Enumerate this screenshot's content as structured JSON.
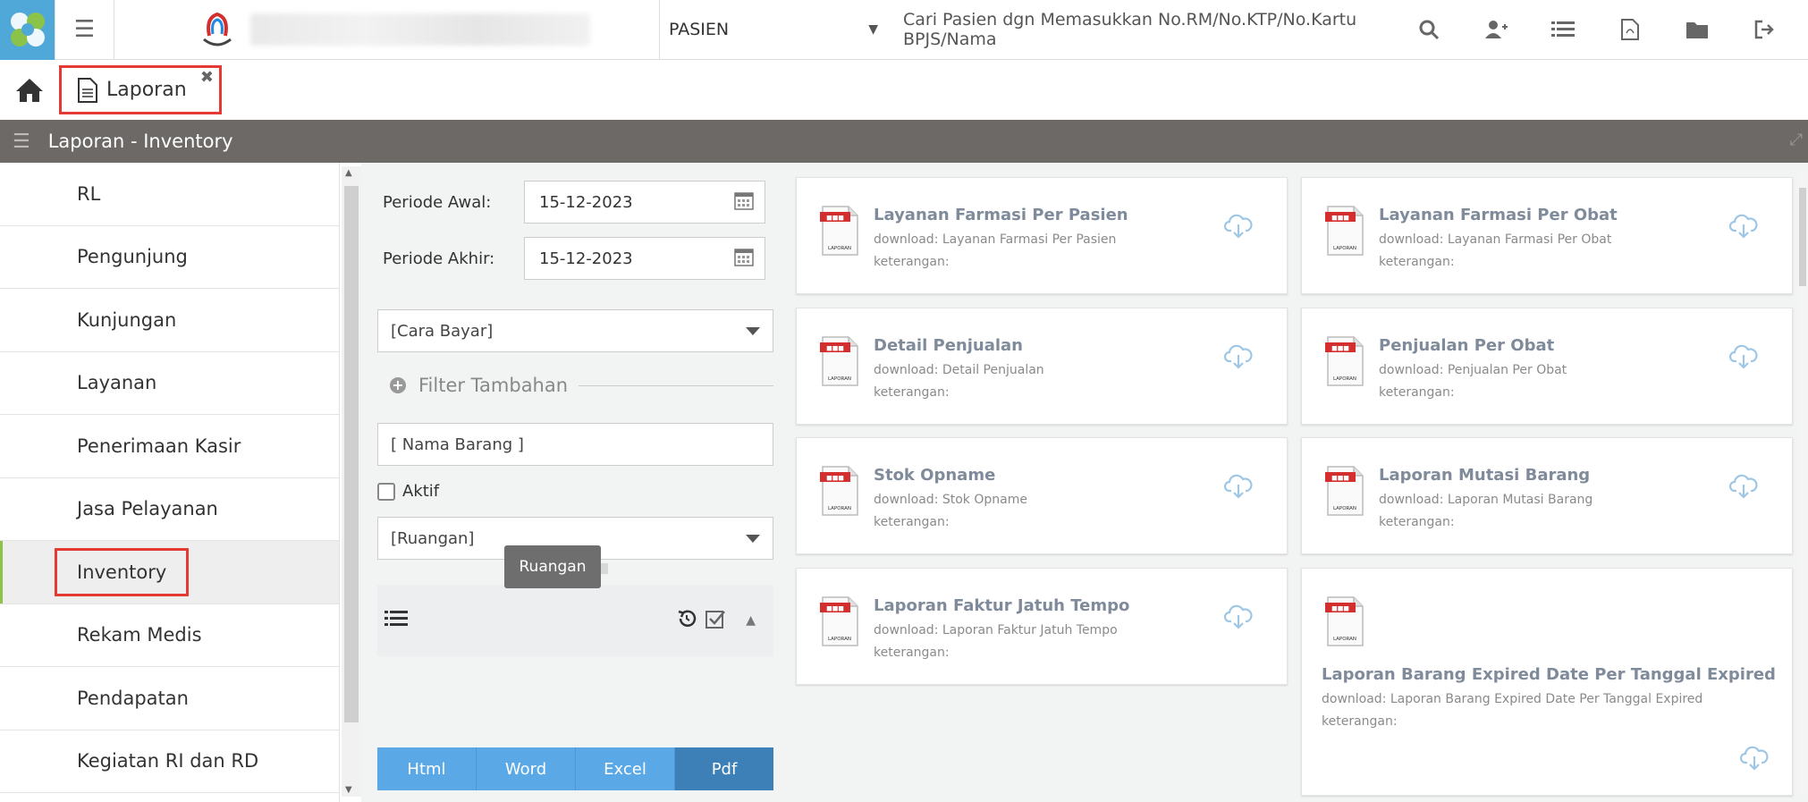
{
  "header": {
    "pasien_select": "PASIEN",
    "search_placeholder": "Cari Pasien dgn Memasukkan No.RM/No.KTP/No.Kartu BPJS/Nama",
    "icons": [
      "search-icon",
      "add-user-icon",
      "list-icon",
      "pdf-file-icon",
      "folder-icon",
      "logout-icon"
    ]
  },
  "tabs": [
    {
      "label": "Laporan"
    }
  ],
  "section": {
    "title": "Laporan - Inventory"
  },
  "sidebar": {
    "items": [
      {
        "label": "RL"
      },
      {
        "label": "Pengunjung"
      },
      {
        "label": "Kunjungan"
      },
      {
        "label": "Layanan"
      },
      {
        "label": "Penerimaan Kasir"
      },
      {
        "label": "Jasa Pelayanan"
      },
      {
        "label": "Inventory",
        "active": true
      },
      {
        "label": "Rekam Medis"
      },
      {
        "label": "Pendapatan"
      },
      {
        "label": "Kegiatan RI dan RD"
      }
    ]
  },
  "filter": {
    "periode_awal_label": "Periode Awal:",
    "periode_awal_value": "15-12-2023",
    "periode_akhir_label": "Periode Akhir:",
    "periode_akhir_value": "15-12-2023",
    "cara_bayar": "[Cara Bayar]",
    "filter_tambahan": "Filter Tambahan",
    "nama_barang_placeholder": "[ Nama Barang ]",
    "aktif_label": "Aktif",
    "ruangan": "[Ruangan]",
    "tooltip": "Ruangan",
    "export_buttons": [
      "Html",
      "Word",
      "Excel",
      "Pdf"
    ]
  },
  "reports": [
    {
      "title": "Layanan Farmasi Per Pasien",
      "download": "download: Layanan Farmasi Per Pasien",
      "keterangan": "keterangan:"
    },
    {
      "title": "Layanan Farmasi Per Obat",
      "download": "download: Layanan Farmasi Per Obat",
      "keterangan": "keterangan:"
    },
    {
      "title": "Detail Penjualan",
      "download": "download: Detail Penjualan",
      "keterangan": "keterangan:"
    },
    {
      "title": "Penjualan Per Obat",
      "download": "download: Penjualan Per Obat",
      "keterangan": "keterangan:"
    },
    {
      "title": "Stok Opname",
      "download": "download: Stok Opname",
      "keterangan": "keterangan:"
    },
    {
      "title": "Laporan Mutasi Barang",
      "download": "download: Laporan Mutasi Barang",
      "keterangan": "keterangan:"
    },
    {
      "title": "Laporan Faktur Jatuh Tempo",
      "download": "download: Laporan Faktur Jatuh Tempo",
      "keterangan": "keterangan:"
    },
    {
      "title": "Laporan Barang Expired Date Per Tanggal Expired",
      "download": "download: Laporan Barang Expired Date Per Tanggal Expired",
      "keterangan": "keterangan:"
    }
  ],
  "pdf_icon_caption": "LAPORAN",
  "colors": {
    "highlight": "#e53935",
    "section_bar": "#6d6967",
    "export_blue": "#5aa9e6",
    "pdf_button": "#3d80b8"
  }
}
